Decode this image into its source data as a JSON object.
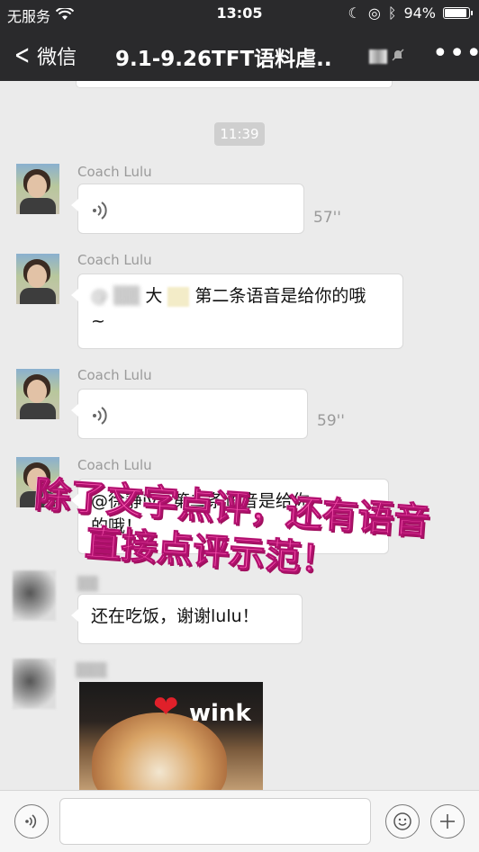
{
  "status_bar": {
    "carrier": "无服务",
    "time": "13:05",
    "battery": "94%",
    "battery_level": 0.94,
    "icons": [
      "wifi-icon",
      "moon-icon",
      "location-icon",
      "bluetooth-icon",
      "battery-icon"
    ]
  },
  "nav": {
    "back_label": "微信",
    "title": "9.1-9.26TFT语料虐..",
    "icons": [
      "chevron-left-icon",
      "mute-icon",
      "more-icon"
    ]
  },
  "chat": {
    "timestamp": "11:39",
    "messages": [
      {
        "sender": "Coach Lulu",
        "type": "voice",
        "duration": "57''"
      },
      {
        "sender": "Coach Lulu",
        "type": "text",
        "text_line1": "大",
        "text_line1b": "第二条语音是给你的哦",
        "text_line2": "~"
      },
      {
        "sender": "Coach Lulu",
        "type": "voice",
        "duration": "59''"
      },
      {
        "sender": "Coach Lulu",
        "type": "text",
        "text_line1": "@徐静ivy",
        "text_line1b": "第二条语音是给你",
        "text_line2": "的哦！"
      },
      {
        "sender": "",
        "type": "text",
        "text": "还在吃饭，谢谢lulu！"
      },
      {
        "sender": "",
        "type": "sticker",
        "sticker_text": "wink",
        "sticker_icon": "heart-icon"
      }
    ],
    "overlay": {
      "line1": "除了文字点评，还有语音",
      "line2": "直接点评示范！"
    }
  },
  "input_bar": {
    "icons": [
      "voice-input-icon",
      "emoji-icon",
      "plus-icon"
    ]
  }
}
